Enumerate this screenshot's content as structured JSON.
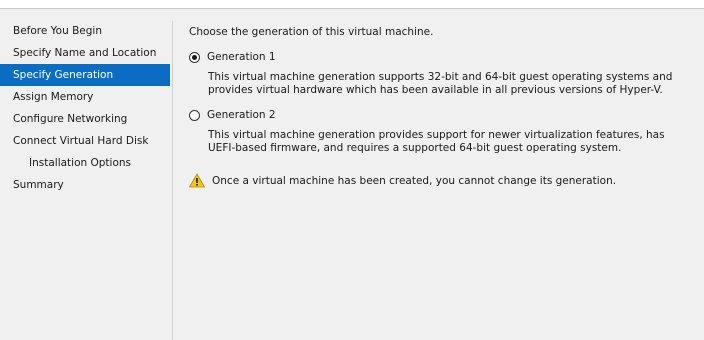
{
  "nav": {
    "items": [
      {
        "label": "Before You Begin"
      },
      {
        "label": "Specify Name and Location"
      },
      {
        "label": "Specify Generation"
      },
      {
        "label": "Assign Memory"
      },
      {
        "label": "Configure Networking"
      },
      {
        "label": "Connect Virtual Hard Disk"
      },
      {
        "label": "Installation Options"
      },
      {
        "label": "Summary"
      }
    ],
    "selected": "Specify Generation"
  },
  "main": {
    "intro": "Choose the generation of this virtual machine.",
    "options": [
      {
        "label": "Generation 1",
        "checked": true,
        "description": "This virtual machine generation supports 32-bit and 64-bit guest operating systems and provides virtual hardware which has been available in all previous versions of Hyper-V."
      },
      {
        "label": "Generation 2",
        "checked": false,
        "description": "This virtual machine generation provides support for newer virtualization features, has UEFI-based firmware, and requires a supported 64-bit guest operating system."
      }
    ],
    "warning": {
      "icon": "warning-icon",
      "text": "Once a virtual machine has been created, you cannot change its generation."
    }
  },
  "colors": {
    "selection": "#0b6cc4",
    "background": "#f0f0f0",
    "warning": "#f5c518"
  }
}
